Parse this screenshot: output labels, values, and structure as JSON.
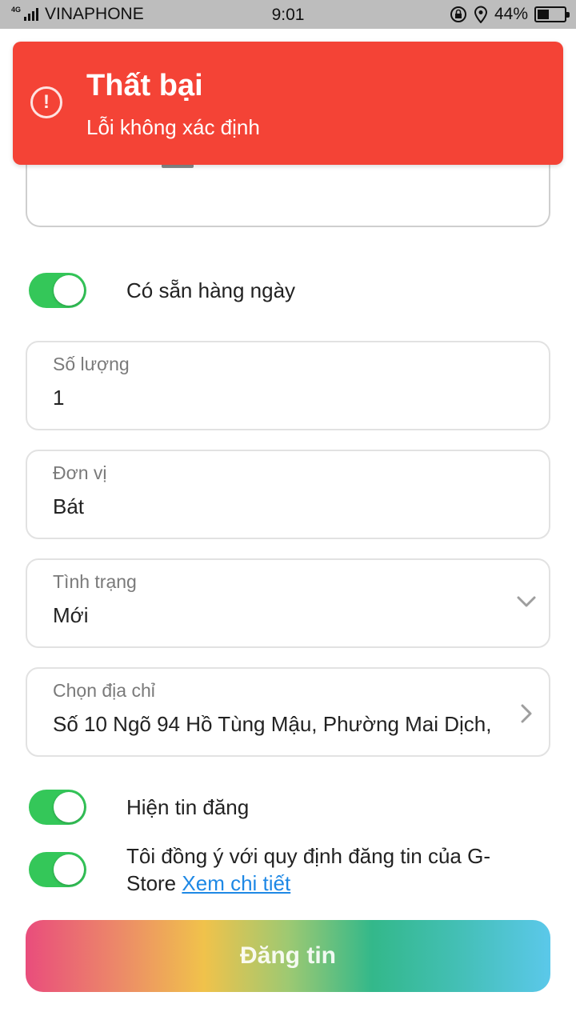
{
  "status_bar": {
    "network": "4G",
    "carrier": "VINAPHONE",
    "time": "9:01",
    "battery_percent": "44%",
    "battery_level": 0.44,
    "icons": [
      "signal-icon",
      "rotation-lock-icon",
      "location-icon",
      "battery-icon"
    ]
  },
  "toast": {
    "title": "Thất bại",
    "message": "Lỗi không xác định",
    "icon": "alert-circle-icon",
    "color": "#f44336"
  },
  "toggles": {
    "daily_available": {
      "label": "Có sẵn hàng ngày",
      "on": true
    },
    "show_post": {
      "label": "Hiện tin đăng",
      "on": true
    },
    "agree_terms": {
      "label": "Tôi đồng ý với quy định đăng tin của G-Store",
      "link": "Xem chi tiết",
      "on": true
    }
  },
  "fields": {
    "quantity": {
      "label": "Số lượng",
      "value": "1"
    },
    "unit": {
      "label": "Đơn vị",
      "value": "Bát"
    },
    "condition": {
      "label": "Tình trạng",
      "value": "Mới"
    },
    "address": {
      "label": "Chọn địa chỉ",
      "value": "Số 10 Ngõ 94 Hồ Tùng Mậu, Phường Mai Dịch,"
    }
  },
  "submit_button": {
    "label": "Đăng tin"
  },
  "colors": {
    "switch_on": "#34c759",
    "link": "#1e88e5",
    "toast": "#f44336"
  }
}
